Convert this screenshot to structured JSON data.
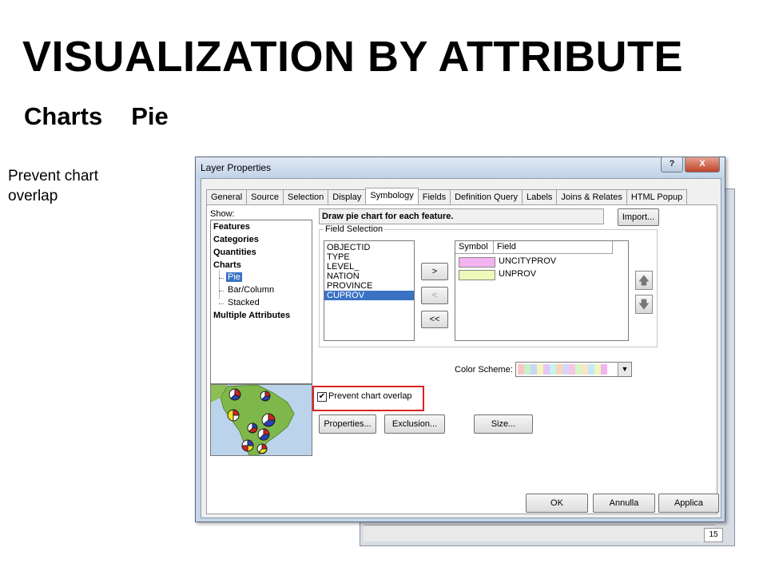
{
  "slide": {
    "title": "VISUALIZATION  BY ATTRIBUTE",
    "subtitle_a": "Charts",
    "subtitle_b": "Pie",
    "note": "Prevent chart overlap"
  },
  "background_window": {
    "page_num": "15"
  },
  "dialog": {
    "title": "Layer Properties",
    "help_label": "?",
    "close_label": "X",
    "tabs": [
      "General",
      "Source",
      "Selection",
      "Display",
      "Symbology",
      "Fields",
      "Definition Query",
      "Labels",
      "Joins & Relates",
      "HTML Popup"
    ],
    "active_tab": "Symbology",
    "show_label": "Show:",
    "tree": {
      "features": "Features",
      "categories": "Categories",
      "quantities": "Quantities",
      "charts": "Charts",
      "pie": "Pie",
      "bar_column": "Bar/Column",
      "stacked": "Stacked",
      "multiple": "Multiple Attributes"
    },
    "description": "Draw pie chart for each feature.",
    "import_label": "Import...",
    "field_selection_label": "Field Selection",
    "fields": [
      "OBJECTID",
      "TYPE",
      "LEVEL_",
      "NATION",
      "PROVINCE",
      "CUPROV"
    ],
    "selected_field": "CUPROV",
    "add_label": ">",
    "remove_label": "<",
    "remove_all_label": "<<",
    "symbol_col": "Symbol",
    "field_col": "Field",
    "symbol_rows": [
      {
        "field": "UNCITYPROV",
        "color": "#f2b3f0"
      },
      {
        "field": "UNPROV",
        "color": "#eef8b8"
      }
    ],
    "up_icon": "up-arrow-icon",
    "down_icon": "down-arrow-icon",
    "color_scheme_label": "Color Scheme:",
    "color_scheme_colors": [
      "#f9c6c6",
      "#c6f2c6",
      "#c6d6f9",
      "#f6f6b8",
      "#e6c6f6",
      "#c6f2f2",
      "#f9d6b8",
      "#d6d6f9",
      "#f6c6e6",
      "#d6f6c6",
      "#f9e6c6",
      "#c6e6f9",
      "#eef8b8",
      "#f2b3f0"
    ],
    "prevent_overlap_label": "Prevent chart overlap",
    "prevent_overlap_checked": true,
    "properties_label": "Properties...",
    "exclusion_label": "Exclusion...",
    "size_label": "Size...",
    "ok_label": "OK",
    "cancel_label": "Annulla",
    "apply_label": "Applica"
  }
}
